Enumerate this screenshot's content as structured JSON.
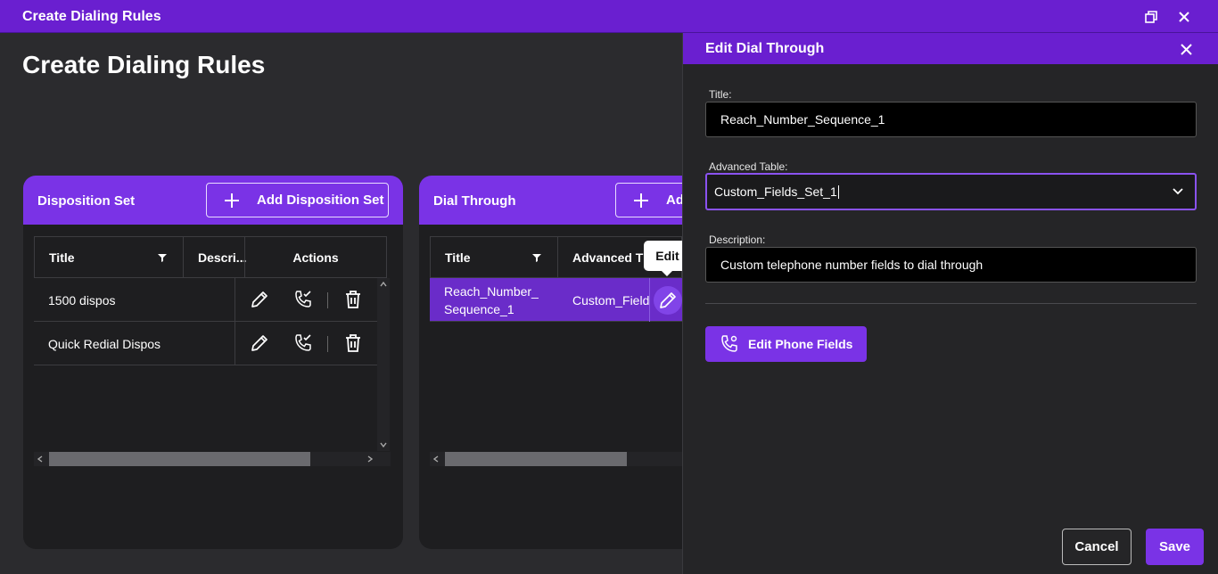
{
  "window": {
    "title": "Create Dialing Rules"
  },
  "page": {
    "title": "Create Dialing Rules"
  },
  "disposition_set": {
    "title": "Disposition Set",
    "add_label": "Add Disposition Set",
    "columns": [
      "Title",
      "Descri...",
      "Actions"
    ],
    "rows": [
      {
        "title": "1500 dispos"
      },
      {
        "title": "Quick Redial Dispos"
      }
    ]
  },
  "dial_through": {
    "title": "Dial Through",
    "add_label": "Ad",
    "columns": [
      "Title",
      "Advanced T"
    ],
    "rows": [
      {
        "title": "Reach_Number_\nSequence_1",
        "advanced": "Custom_Field"
      }
    ],
    "tooltip": "Edit"
  },
  "drawer": {
    "title": "Edit Dial Through",
    "title_label": "Title:",
    "title_value": "Reach_Number_Sequence_1",
    "advanced_label": "Advanced Table:",
    "advanced_value": "Custom_Fields_Set_1",
    "description_label": "Description:",
    "description_value": "Custom telephone number fields to dial through",
    "phone_button": "Edit Phone Fields",
    "cancel": "Cancel",
    "save": "Save"
  },
  "colors": {
    "accent": "#7a33e6",
    "titlebar": "#6a1fd0",
    "background": "#2b2b2e"
  }
}
